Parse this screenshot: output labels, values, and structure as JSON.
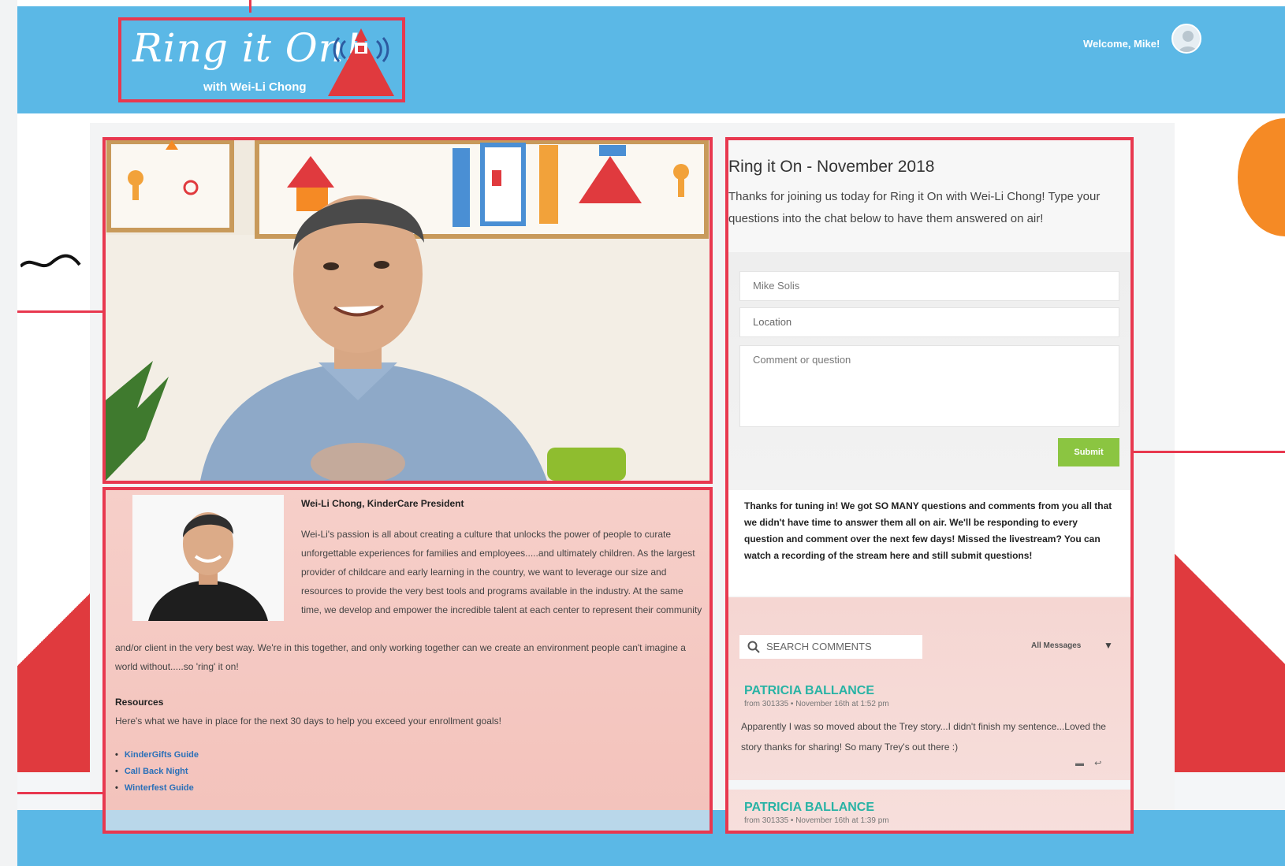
{
  "header": {
    "logo_title": "Ring it On!",
    "logo_subtitle": "with Wei-Li Chong",
    "welcome_text": "Welcome, Mike!"
  },
  "bio": {
    "name": "Wei-Li Chong, KinderCare President",
    "text_part1": "Wei-Li's passion is all about creating a culture that unlocks the power of people to curate unforgettable experiences for families and employees.....and ultimately children. As the largest provider of childcare and early learning in the country, we want to leverage our size and resources to provide the very best tools and programs available in the industry. At the same time, we develop and empower the incredible talent at each center to represent their community",
    "text_part2": "and/or client in the very best way. We're in this together, and only working together can we create an environment people can't imagine a world without.....so 'ring' it on!",
    "resources_heading": "Resources",
    "resources_text": "Here's what we have in place for the next 30 days to help you exceed your enrollment goals!",
    "resources_links": [
      "KinderGifts Guide",
      "Call Back Night",
      "Winterfest Guide"
    ]
  },
  "chat": {
    "title": "Ring it On - November 2018",
    "intro": "Thanks for joining us today for Ring it On with Wei-Li Chong! Type your questions into the chat below to have them answered on air!",
    "name_value": "Mike Solis",
    "location_placeholder": "Location",
    "comment_placeholder": "Comment or question",
    "submit_label": "Submit",
    "notice": "Thanks for tuning in! We got SO MANY questions and comments from you all that we didn't have time to answer them all on air. We'll be responding to every question and comment over the next few days! Missed the livestream? You can watch a recording of the stream here and still submit questions!",
    "search_placeholder": "SEARCH COMMENTS",
    "filter_label": "All Messages",
    "comments": [
      {
        "name": "PATRICIA BALLANCE",
        "meta": "from 301335 • November 16th at 1:52 pm",
        "text": "Apparently I was so moved about the Trey story...I didn't finish my sentence...Loved the story thanks for sharing! So many Trey's out there :)"
      },
      {
        "name": "PATRICIA BALLANCE",
        "meta": "from 301335 • November 16th at 1:39 pm",
        "text": ""
      }
    ]
  },
  "colors": {
    "header_blue": "#5bb8e6",
    "annotation_red": "#e8384f",
    "submit_green": "#8bc541",
    "commenter_teal": "#29b3a5",
    "deco_red": "#e03a3e",
    "deco_orange": "#f58a25"
  }
}
